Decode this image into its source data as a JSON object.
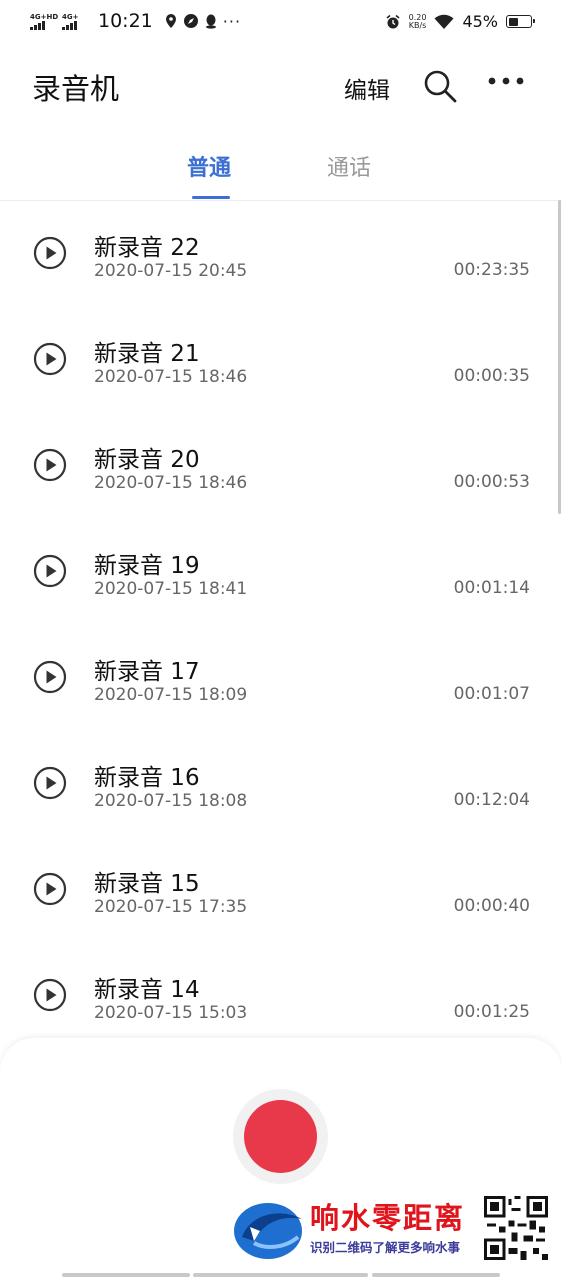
{
  "status_bar": {
    "net1_label": "4G+HD",
    "net2_label": "4G+",
    "time": "10:21",
    "speed_value": "0.20",
    "speed_unit": "KB/s",
    "battery_percent": "45%",
    "battery_level": 0.45,
    "more_dots": "···"
  },
  "header": {
    "title": "录音机",
    "edit_label": "编辑"
  },
  "tabs": [
    {
      "label": "普通",
      "active": true
    },
    {
      "label": "通话",
      "active": false
    }
  ],
  "recordings": [
    {
      "name": "新录音 22",
      "date": "2020-07-15 20:45",
      "duration": "00:23:35"
    },
    {
      "name": "新录音 21",
      "date": "2020-07-15 18:46",
      "duration": "00:00:35"
    },
    {
      "name": "新录音 20",
      "date": "2020-07-15 18:46",
      "duration": "00:00:53"
    },
    {
      "name": "新录音 19",
      "date": "2020-07-15 18:41",
      "duration": "00:01:14"
    },
    {
      "name": "新录音 17",
      "date": "2020-07-15 18:09",
      "duration": "00:01:07"
    },
    {
      "name": "新录音 16",
      "date": "2020-07-15 18:08",
      "duration": "00:12:04"
    },
    {
      "name": "新录音 15",
      "date": "2020-07-15 17:35",
      "duration": "00:00:40"
    },
    {
      "name": "新录音 14",
      "date": "2020-07-15 15:03",
      "duration": "00:01:25"
    }
  ],
  "watermark": {
    "title": "响水零距离",
    "subtitle": "识别二维码了解更多响水事"
  },
  "colors": {
    "accent": "#3b6fd4",
    "record": "#e8394b",
    "inactive_tab": "#9a9a9a"
  }
}
